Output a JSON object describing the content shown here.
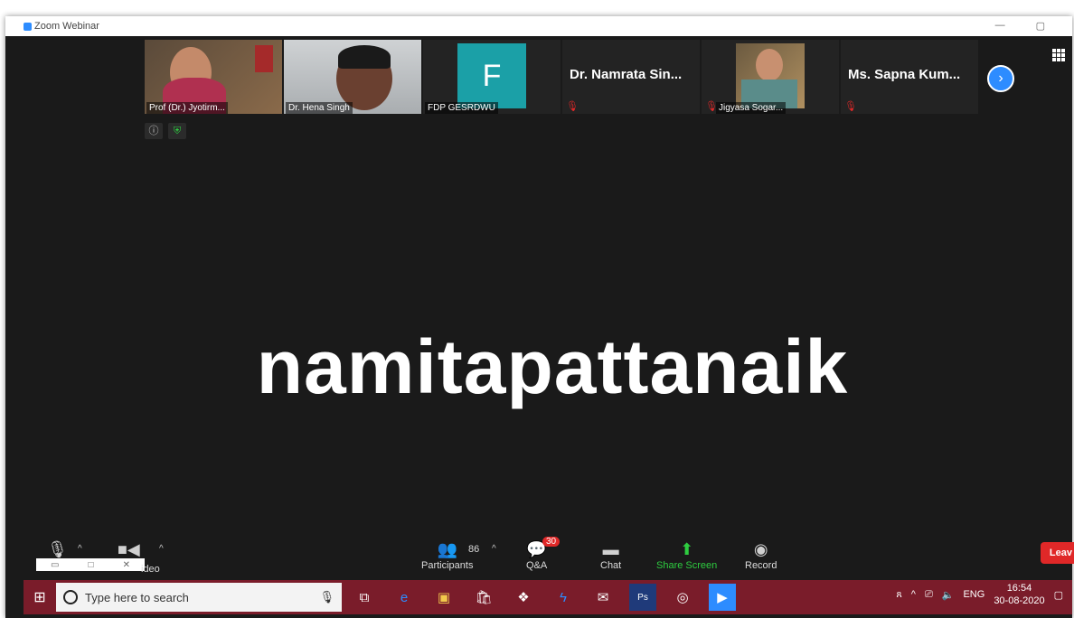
{
  "window": {
    "title": "Zoom Webinar"
  },
  "thumbnails": [
    {
      "name": "Prof (Dr.) Jyotirm...",
      "type": "video"
    },
    {
      "name": "Dr. Hena Singh",
      "type": "video"
    },
    {
      "name": "FDP GESRDWU",
      "type": "avatar",
      "initial": "F"
    },
    {
      "name": "Dr. Namrata Sin...",
      "type": "name-only",
      "muted": true
    },
    {
      "name": "Jigyasa Sogar...",
      "type": "video",
      "muted": true
    },
    {
      "name": "Ms. Sapna Kum...",
      "type": "name-only",
      "muted": true
    }
  ],
  "active_speaker": "namitapattanaik",
  "toolbar": {
    "video_label": "ideo",
    "participants_label": "Participants",
    "participants_count": "86",
    "qa_label": "Q&A",
    "qa_badge": "30",
    "chat_label": "Chat",
    "share_label": "Share Screen",
    "record_label": "Record",
    "leave_label": "Leav"
  },
  "taskbar": {
    "search_placeholder": "Type here to search",
    "lang": "ENG",
    "time": "16:54",
    "date": "30-08-2020"
  },
  "colors": {
    "accent": "#2d8cff",
    "share": "#2ecc40",
    "leave": "#e02828",
    "taskbar": "#7a1c2a"
  }
}
